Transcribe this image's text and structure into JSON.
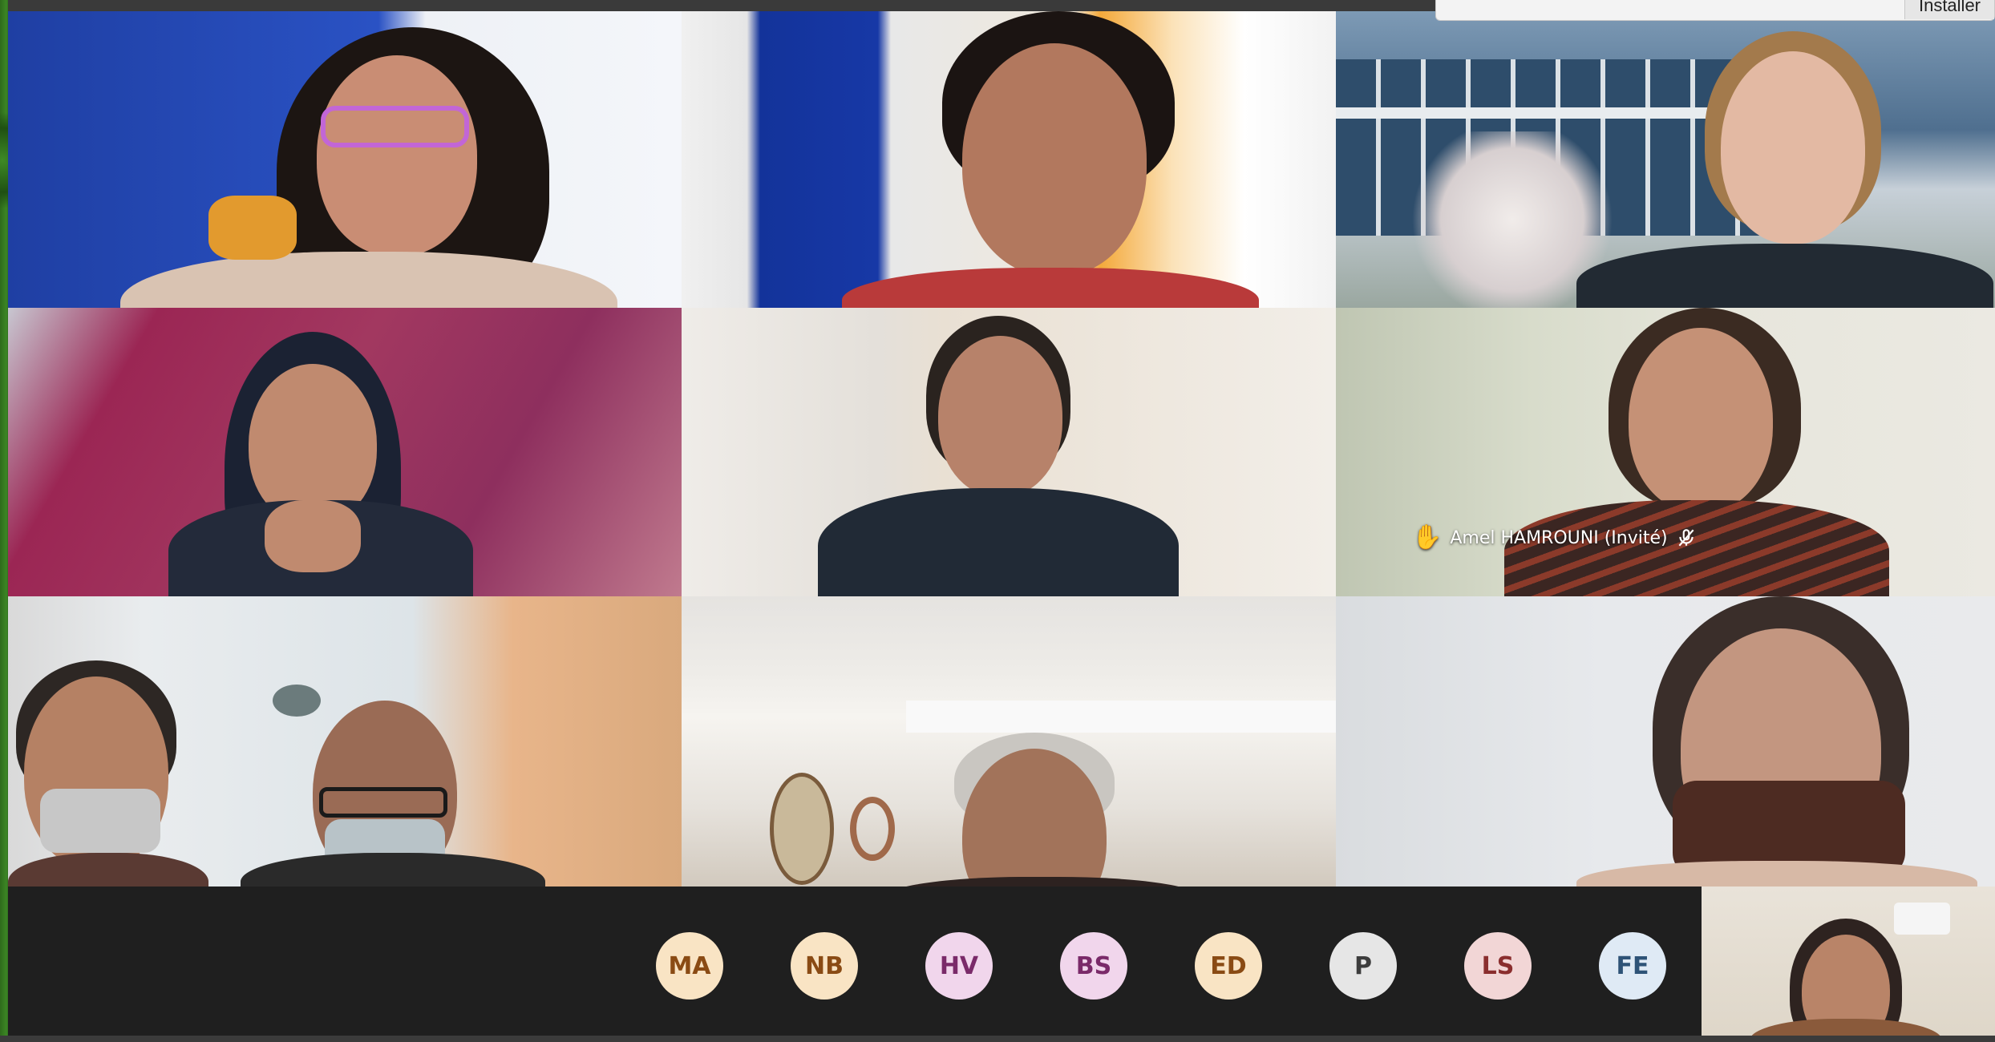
{
  "popup": {
    "install_label": "Installer"
  },
  "participants": {
    "raised_hand_name": "Amel HAMROUNI (Invité)"
  },
  "avatars": [
    {
      "initials": "MA",
      "bg": "#f9e4c4",
      "fg": "#8a4b14"
    },
    {
      "initials": "NB",
      "bg": "#f9e4c4",
      "fg": "#8a4b14"
    },
    {
      "initials": "HV",
      "bg": "#f1d6ec",
      "fg": "#7a2a69"
    },
    {
      "initials": "BS",
      "bg": "#f1d6ec",
      "fg": "#7a2a69"
    },
    {
      "initials": "ED",
      "bg": "#f9e4c4",
      "fg": "#8a4b14"
    },
    {
      "initials": "P",
      "bg": "#e6e6e6",
      "fg": "#3d3d3d"
    },
    {
      "initials": "LS",
      "bg": "#f2d6d6",
      "fg": "#8a2e2e"
    },
    {
      "initials": "FE",
      "bg": "#dfeaf5",
      "fg": "#2e5377"
    }
  ],
  "icons": {
    "raised_hand": "raised-hand-icon",
    "mic_off": "microphone-off-icon"
  }
}
